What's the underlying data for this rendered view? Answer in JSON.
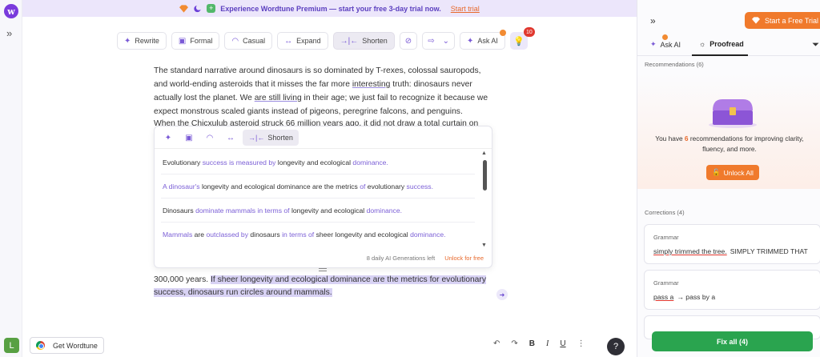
{
  "banner": {
    "text": "Experience Wordtune Premium — start your free 3-day trial now.",
    "cta": "Start trial"
  },
  "toolbar": {
    "rewrite": "Rewrite",
    "formal": "Formal",
    "casual": "Casual",
    "expand": "Expand",
    "shorten": "Shorten",
    "ask_ai": "Ask AI",
    "badge_count": "10"
  },
  "document": {
    "para1_a": "The standard narrative around dinosaurs is so dominated by T-rexes, colossal sauropods, and world-ending asteroids that it misses the far more ",
    "para1_u1": "interesting",
    "para1_b": " truth: dinosaurs never actually lost the planet. We ",
    "para1_u2": "are still living",
    "para1_c": " in their age; we just fail to recognize it because we expect monstrous scaled giants instead of pigeons, peregrine falcons, and penguins.",
    "para2": "When the Chicxulub asteroid struck 66 million years ago, it did not draw a total curtain on",
    "para3_lead": "300,000 years. ",
    "para3_highlight": "If sheer longevity and ecological dominance are the metrics for evolutionary success, dinosaurs run circles around mammals."
  },
  "popup": {
    "active_tool": "Shorten",
    "suggestions": [
      [
        {
          "t": "Evolutionary ",
          "c": false
        },
        {
          "t": "success is measured by",
          "c": true
        },
        {
          "t": " longevity and ecological ",
          "c": false
        },
        {
          "t": "dominance.",
          "c": true
        }
      ],
      [
        {
          "t": "A dinosaur's",
          "c": true
        },
        {
          "t": " longevity and ecological dominance are the metrics ",
          "c": false
        },
        {
          "t": "of",
          "c": true
        },
        {
          "t": " evolutionary ",
          "c": false
        },
        {
          "t": "success.",
          "c": true
        }
      ],
      [
        {
          "t": "Dinosaurs ",
          "c": false
        },
        {
          "t": "dominate mammals in terms of",
          "c": true
        },
        {
          "t": " longevity and ecological ",
          "c": false
        },
        {
          "t": "dominance.",
          "c": true
        }
      ],
      [
        {
          "t": "Mammals",
          "c": true
        },
        {
          "t": " are ",
          "c": false
        },
        {
          "t": "outclassed by",
          "c": true
        },
        {
          "t": " dinosaurs ",
          "c": false
        },
        {
          "t": "in terms of",
          "c": true
        },
        {
          "t": " sheer longevity and ecological ",
          "c": false
        },
        {
          "t": "dominance.",
          "c": true
        }
      ]
    ],
    "generations_left": "8 daily AI Generations left",
    "unlock": "Unlock for free"
  },
  "bottom": {
    "get_wordtune": "Get Wordtune",
    "avatar_letter": "L",
    "help": "?"
  },
  "panel": {
    "trial_button": "Start a Free Trial",
    "tab_ask": "Ask AI",
    "tab_proofread": "Proofread",
    "recommendations_label": "Recommendations (6)",
    "rec_text_a": "You have ",
    "rec_count": "6",
    "rec_text_b": " recommendations for improving clarity, fluency, and more.",
    "unlock_all": "Unlock All",
    "corrections_label": "Corrections (4)",
    "corrections": [
      {
        "kind": "Grammar",
        "error": "simply trimmed the tree.",
        "fix": "SIMPLY TRIMMED THAT"
      },
      {
        "kind": "Grammar",
        "error": "pass a",
        "fix": "→ pass by a"
      }
    ],
    "fix_all": "Fix all (4)"
  },
  "colors": {
    "accent": "#7a5ad6",
    "orange": "#f07a2c",
    "green": "#2aa44f",
    "highlight": "#d8d2f4"
  }
}
